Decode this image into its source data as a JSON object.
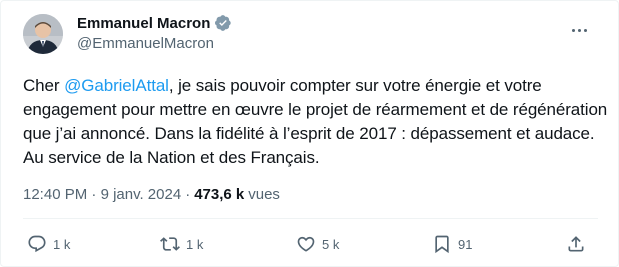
{
  "author": {
    "name": "Emmanuel Macron",
    "handle": "@EmmanuelMacron"
  },
  "tweet": {
    "text_before_mention": "Cher ",
    "mention": "@GabrielAttal",
    "text_after_mention": ", je sais pouvoir compter sur votre énergie et votre engagement pour mettre en œuvre le projet de réarmement et de régénération que j’ai annoncé. Dans la fidélité à l’esprit de 2017 : dépassement et audace. Au service de la Nation et des Français."
  },
  "meta": {
    "time": "12:40 PM",
    "separator": "·",
    "date": "9 janv. 2024",
    "views_count": "473,6 k",
    "views_label": "vues"
  },
  "actions": {
    "replies": "1 k",
    "reposts": "1 k",
    "likes": "5 k",
    "bookmarks": "91"
  },
  "icons": {
    "verified": "verified-badge-icon",
    "more": "more-options-icon",
    "reply": "reply-icon",
    "repost": "repost-icon",
    "like": "heart-icon",
    "bookmark": "bookmark-icon",
    "share": "share-icon"
  },
  "colors": {
    "text": "#0f1419",
    "secondary": "#536471",
    "accent": "#1d9bf0",
    "divider": "#eff3f4"
  }
}
